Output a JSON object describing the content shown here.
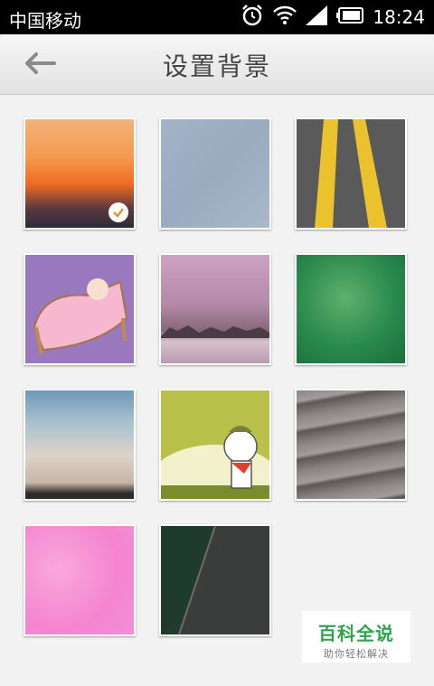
{
  "status_bar": {
    "carrier": "中国移动",
    "time": "18:24",
    "icons": [
      "alarm-icon",
      "wifi-icon",
      "signal-icon",
      "battery-icon"
    ]
  },
  "header": {
    "title": "设置背景",
    "back_icon": "back-arrow-icon"
  },
  "backgrounds": [
    {
      "name": "sunset-orange",
      "selected": true
    },
    {
      "name": "blue-gray-texture",
      "selected": false
    },
    {
      "name": "road-yellow-lines",
      "selected": false
    },
    {
      "name": "bunny-in-bed",
      "selected": false
    },
    {
      "name": "misty-purple-lake",
      "selected": false
    },
    {
      "name": "green-leaf",
      "selected": false
    },
    {
      "name": "foggy-sky",
      "selected": false
    },
    {
      "name": "mi-bunny-cartoon",
      "selected": false
    },
    {
      "name": "wet-wood-planks",
      "selected": false
    },
    {
      "name": "pink-floral",
      "selected": false
    },
    {
      "name": "dark-metal-texture",
      "selected": false
    }
  ],
  "watermark": {
    "title": "百科全说",
    "subtitle": "助你轻松解决"
  },
  "colors": {
    "accent_check": "#e8932f",
    "watermark_green": "#2fa44a"
  }
}
